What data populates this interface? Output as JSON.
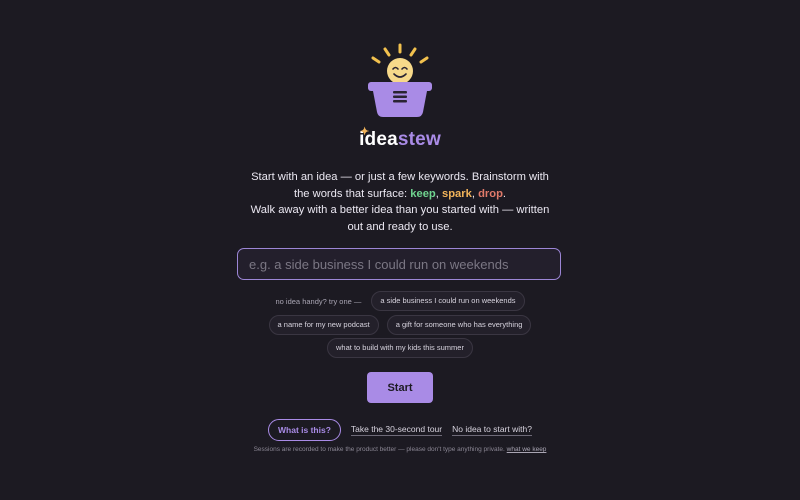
{
  "brand": {
    "word_part1": "idea",
    "word_part2": "stew",
    "logo_icon": "lightbulb-in-pot-icon",
    "spark_icon": "sparkle-icon",
    "colors": {
      "accent": "#a98be6",
      "background": "#1c1a22",
      "keep": "#6fd38f",
      "spark": "#f2b45a",
      "drop": "#e07a6a"
    }
  },
  "intro": {
    "line1": "Start with an idea — or just a few keywords. Brainstorm with",
    "line2_prefix": "the words that surface: ",
    "kw_keep": "keep",
    "comma1": ", ",
    "kw_spark": "spark",
    "comma2": ", ",
    "kw_drop": "drop",
    "period": ".",
    "line3": "Walk away with a better idea than you started with — written",
    "line4": "out and ready to use."
  },
  "search": {
    "placeholder": "e.g. a side business I could run on weekends",
    "value": ""
  },
  "suggestions": {
    "label": "no idea handy? try one —",
    "items": [
      "a side business I could run on weekends",
      "a name for my new podcast",
      "a gift for someone who has everything",
      "what to build with my kids this summer"
    ]
  },
  "start_label": "Start",
  "links": {
    "what": "What is this?",
    "tour": "Take the 30-second tour",
    "no_idea": "No idea to start with?"
  },
  "footnote": {
    "text": "Sessions are recorded to make the product better — please don't type anything private. ",
    "link": "what we keep"
  }
}
